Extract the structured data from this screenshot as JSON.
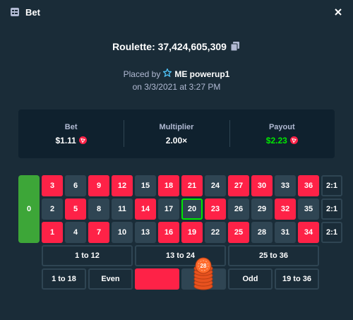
{
  "header": {
    "title": "Bet"
  },
  "game": {
    "label": "Roulette: 37,424,605,309"
  },
  "placed": {
    "prefix": "Placed by",
    "user": "ME powerup1",
    "date": "on 3/3/2021 at 3:27 PM"
  },
  "stats": {
    "bet_label": "Bet",
    "bet_value": "$1.11",
    "multiplier_label": "Multiplier",
    "multiplier_value": "2.00×",
    "payout_label": "Payout",
    "payout_value": "$2.23"
  },
  "board": {
    "zero": "0",
    "rows": [
      [
        {
          "n": "3",
          "c": "red"
        },
        {
          "n": "6",
          "c": "black"
        },
        {
          "n": "9",
          "c": "red"
        },
        {
          "n": "12",
          "c": "red"
        },
        {
          "n": "15",
          "c": "black"
        },
        {
          "n": "18",
          "c": "red"
        },
        {
          "n": "21",
          "c": "red"
        },
        {
          "n": "24",
          "c": "black"
        },
        {
          "n": "27",
          "c": "red"
        },
        {
          "n": "30",
          "c": "red"
        },
        {
          "n": "33",
          "c": "black"
        },
        {
          "n": "36",
          "c": "red"
        },
        {
          "n": "2:1",
          "c": "col"
        }
      ],
      [
        {
          "n": "2",
          "c": "black"
        },
        {
          "n": "5",
          "c": "red"
        },
        {
          "n": "8",
          "c": "black"
        },
        {
          "n": "11",
          "c": "black"
        },
        {
          "n": "14",
          "c": "red"
        },
        {
          "n": "17",
          "c": "black"
        },
        {
          "n": "20",
          "c": "black",
          "sel": true
        },
        {
          "n": "23",
          "c": "red"
        },
        {
          "n": "26",
          "c": "black"
        },
        {
          "n": "29",
          "c": "black"
        },
        {
          "n": "32",
          "c": "red"
        },
        {
          "n": "35",
          "c": "black"
        },
        {
          "n": "2:1",
          "c": "col"
        }
      ],
      [
        {
          "n": "1",
          "c": "red"
        },
        {
          "n": "4",
          "c": "black"
        },
        {
          "n": "7",
          "c": "red"
        },
        {
          "n": "10",
          "c": "black"
        },
        {
          "n": "13",
          "c": "black"
        },
        {
          "n": "16",
          "c": "red"
        },
        {
          "n": "19",
          "c": "red"
        },
        {
          "n": "22",
          "c": "black"
        },
        {
          "n": "25",
          "c": "red"
        },
        {
          "n": "28",
          "c": "black"
        },
        {
          "n": "31",
          "c": "black"
        },
        {
          "n": "34",
          "c": "red"
        },
        {
          "n": "2:1",
          "c": "col"
        }
      ]
    ],
    "dozens": [
      "1 to 12",
      "13 to 24",
      "25 to 36"
    ],
    "evens": {
      "low": "1 to 18",
      "even": "Even",
      "odd": "Odd",
      "high": "19 to 36"
    },
    "chip_value": "28"
  },
  "colors": {
    "red": "#fe2247",
    "black": "#2f4553",
    "green": "#3da638",
    "accent_green": "#00e701"
  }
}
